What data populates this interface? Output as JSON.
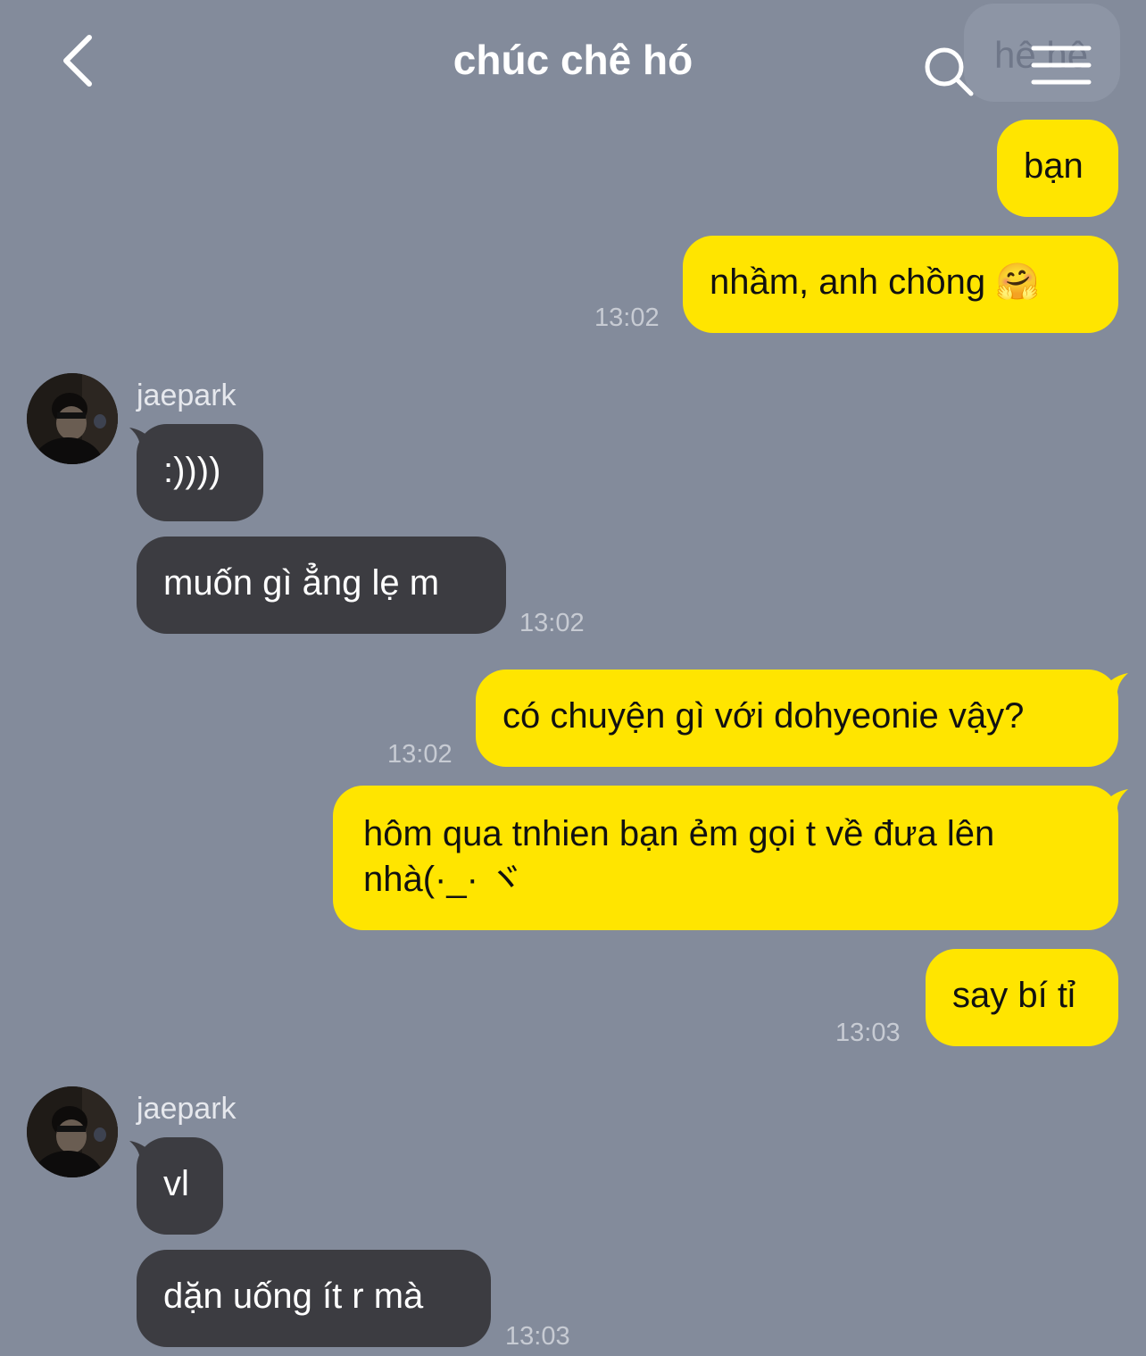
{
  "header": {
    "title": "chúc chê hó",
    "behind_text": "hê hê"
  },
  "messages": [
    {
      "text": "bạn"
    },
    {
      "text": "nhầm, anh chồng 🤗",
      "time": "13:02"
    },
    {
      "sender": "jaepark"
    },
    {
      "text": ":))))"
    },
    {
      "text": "muốn gì ẳng lẹ m",
      "time": "13:02"
    },
    {
      "text": "có chuyện gì với dohyeonie vậy?",
      "time": "13:02"
    },
    {
      "text": "hôm qua tnhien bạn ẻm gọi t về đưa lên nhà(·_· ヾ"
    },
    {
      "text": "say bí tỉ",
      "time": "13:03"
    },
    {
      "sender": "jaepark"
    },
    {
      "text": "vl"
    },
    {
      "text": "dặn uống ít r mà",
      "time": "13:03"
    }
  ],
  "colors": {
    "background": "#838b9b",
    "my_bubble": "#ffe500",
    "their_bubble": "#3c3c41",
    "timestamp": "#c7cbd3"
  },
  "icons": [
    "back-chevron-icon",
    "search-icon",
    "menu-icon",
    "avatar"
  ]
}
